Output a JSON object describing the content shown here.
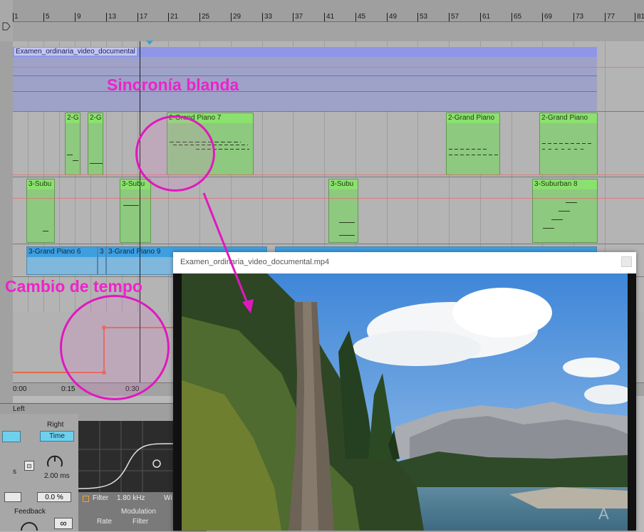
{
  "ruler": {
    "bar_numbers": [
      "1",
      "5",
      "9",
      "13",
      "17",
      "21",
      "25",
      "29",
      "33",
      "37",
      "41",
      "45",
      "49",
      "53",
      "57",
      "61",
      "65",
      "69",
      "73",
      "77",
      "81"
    ]
  },
  "tracks": {
    "video_clip_name": "Examen_ordinaria_video_documental",
    "piano_clips": [
      "2-G",
      "2-G",
      "2-Grand Piano 7",
      "2-Grand Piano",
      "2-Grand Piano"
    ],
    "suburban_clips": [
      "3-Subu",
      "3-Subu",
      "3-Subu",
      "3-Suburban 8"
    ],
    "blue_clips": [
      "3-Grand Piano 6",
      "3",
      "3-Grand Piano 9"
    ]
  },
  "time_ruler": {
    "labels": [
      "0:00",
      "0:15",
      "0:30"
    ]
  },
  "device": {
    "title": "Left",
    "right_label": "Right",
    "time_button": "Time",
    "ms_value": "2.00 ms",
    "s_label": "s",
    "percent_value": "0.0 %",
    "feedback_label": "Feedback",
    "infinity_symbol": "∞",
    "filter_label": "Filter",
    "filter_value": "1.80 kHz",
    "filter_trunc": "Wi",
    "modulation_label": "Modulation",
    "rate_label": "Rate",
    "filter2_label": "Filter"
  },
  "video_window": {
    "title": "Examen_ordinaria_video_documental.mp4"
  },
  "annotations": {
    "soft_sync": "Sincronía blanda",
    "tempo_change": "Cambio de tempo"
  },
  "colors": {
    "annotation": "#ee22cc",
    "video_track": "#8f96e8",
    "midi_clip": "#8dc97f",
    "audio_clip": "#3e9fe0"
  }
}
